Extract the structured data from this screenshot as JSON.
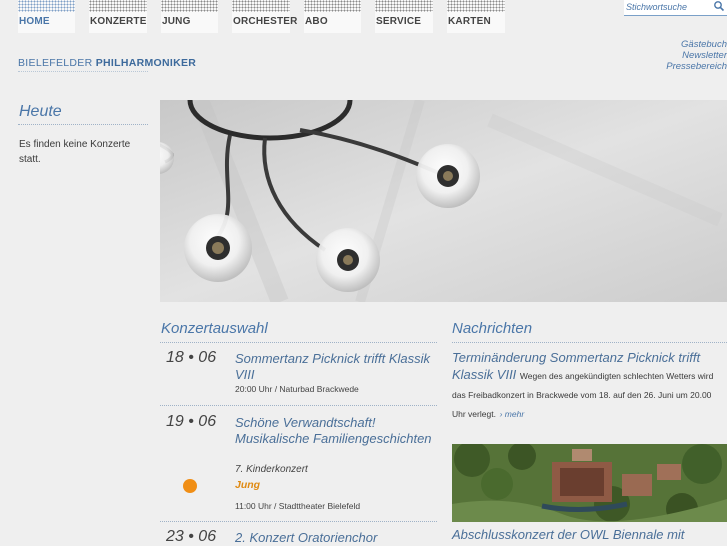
{
  "nav": {
    "items": [
      {
        "label": "HOME",
        "active": true
      },
      {
        "label": "KONZERTE",
        "active": false
      },
      {
        "label": "JUNG",
        "active": false
      },
      {
        "label": "ORCHESTER",
        "active": false
      },
      {
        "label": "ABO",
        "active": false
      },
      {
        "label": "SERVICE",
        "active": false
      },
      {
        "label": "KARTEN",
        "active": false
      }
    ]
  },
  "search": {
    "placeholder": "Stichwortsuche",
    "icon": "search-icon"
  },
  "brand": {
    "prefix": "BIELEFELDER ",
    "name": "PHILHARMONIKER"
  },
  "service_links": [
    "Gästebuch",
    "Newsletter",
    "Pressebereich"
  ],
  "today": {
    "title": "Heute",
    "text": "Es finden keine Konzerte statt."
  },
  "concerts": {
    "title": "Konzertauswahl",
    "items": [
      {
        "date": "18 • 06",
        "title": "Sommertanz Picknick trifft Klassik VIII",
        "meta": "20:00 Uhr / Naturbad Brackwede"
      },
      {
        "date": "19 • 06",
        "title": "Schöne Verwandtschaft! Musikalische Familiengeschichten",
        "subtitle": "7. Kinderkonzert",
        "tag": "Jung",
        "meta": "11:00 Uhr / Stadttheater Bielefeld"
      },
      {
        "date": "23 • 06",
        "title": "2. Konzert Oratorienchor"
      }
    ]
  },
  "news": {
    "title": "Nachrichten",
    "items": [
      {
        "headline": "Terminänderung Sommertanz Picknick trifft Klassik VIII",
        "body": "Wegen des angekündigten schlechten Wetters wird das Freibadkonzert in Brackwede vom 18. auf den 26. Juni um 20.00 Uhr verlegt.",
        "more": "mehr"
      },
      {
        "headline": "Abschlusskonzert der OWL Biennale mit"
      }
    ]
  },
  "colors": {
    "accent": "#4a76a8",
    "tag": "#e08a12",
    "dot": "#f08e15",
    "background": "#efefef"
  }
}
